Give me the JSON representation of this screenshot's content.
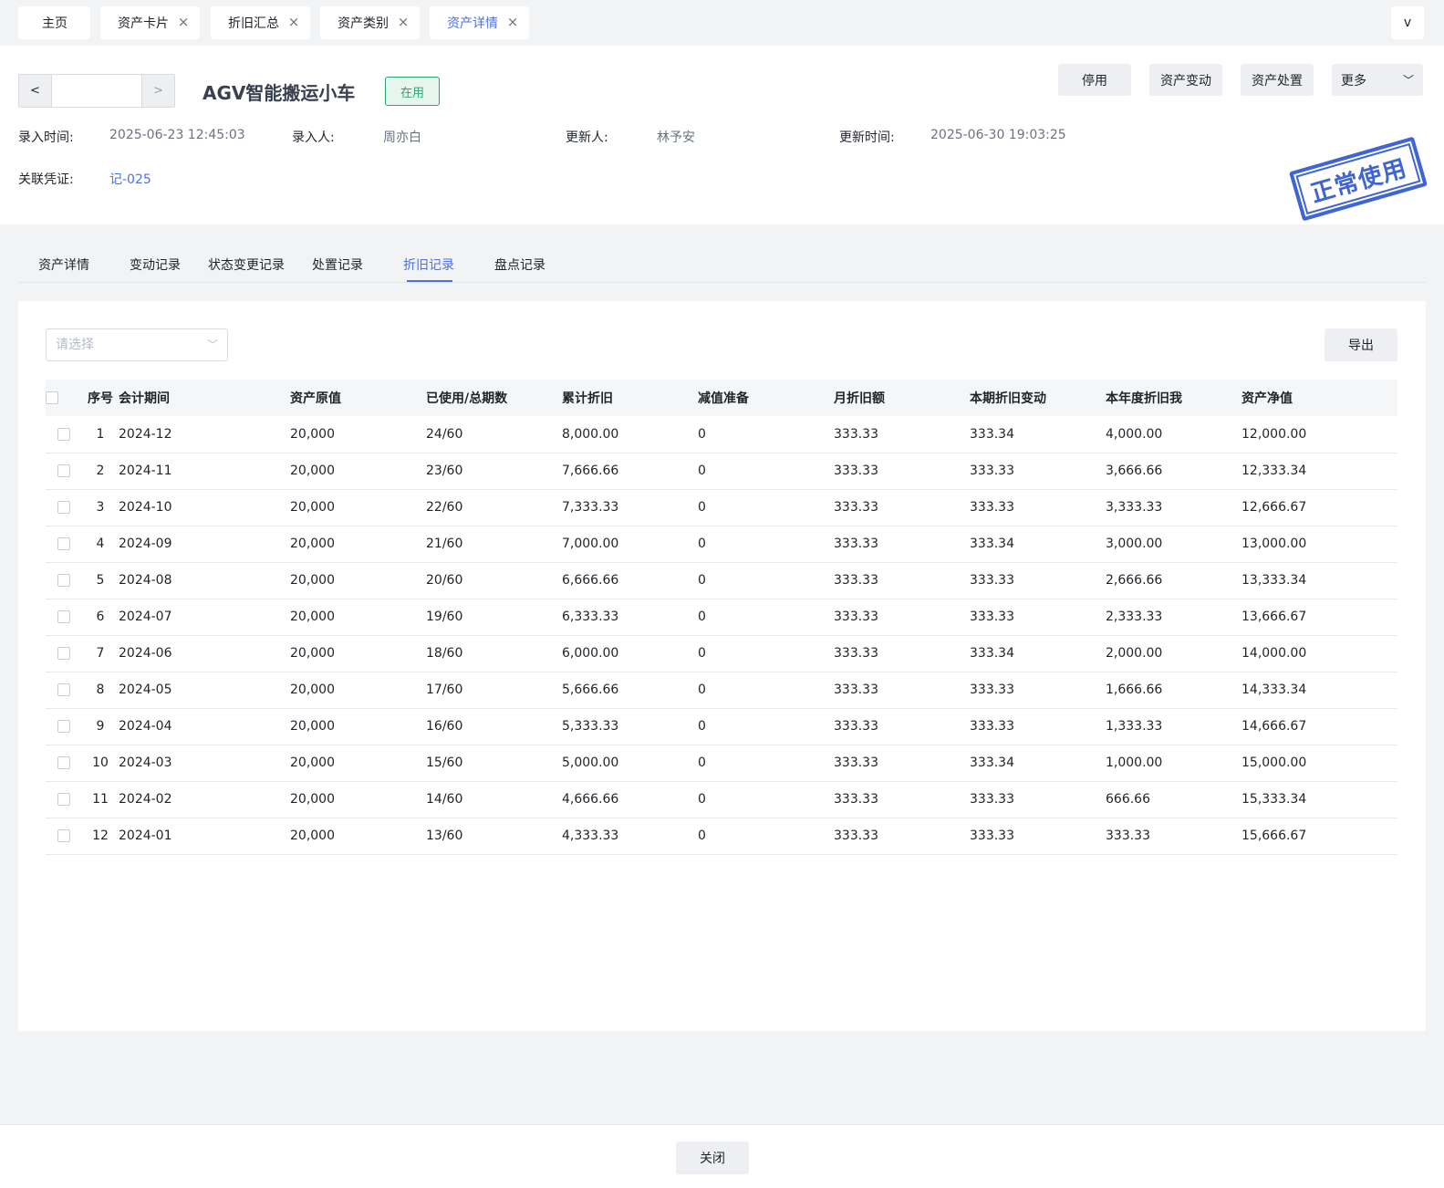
{
  "top_tabs": [
    {
      "label": "主页",
      "closable": false,
      "active": false
    },
    {
      "label": "资产卡片",
      "closable": true,
      "active": false
    },
    {
      "label": "折旧汇总",
      "closable": true,
      "active": false
    },
    {
      "label": "资产类别",
      "closable": true,
      "active": false
    },
    {
      "label": "资产详情",
      "closable": true,
      "active": true
    }
  ],
  "tabs_more_label": "v",
  "header": {
    "pager": {
      "prev": "<",
      "next": ">"
    },
    "asset_name": "AGV智能搬运小车",
    "status": "在用",
    "actions": {
      "disable": "停用",
      "change": "资产变动",
      "dispose": "资产处置",
      "more": "更多"
    },
    "meta": {
      "created_at_label": "录入时间:",
      "created_at": "2025-06-23 12:45:03",
      "creator_label": "录入人:",
      "creator": "周亦白",
      "updater_label": "更新人:",
      "updater": "林予安",
      "updated_at_label": "更新时间:",
      "updated_at": "2025-06-30 19:03:25",
      "voucher_label": "关联凭证:",
      "voucher": "记-025"
    },
    "stamp_text": "正常使用"
  },
  "sub_tabs": [
    "资产详情",
    "变动记录",
    "状态变更记录",
    "处置记录",
    "折旧记录",
    "盘点记录"
  ],
  "active_sub_tab": "折旧记录",
  "filter": {
    "placeholder": "请选择"
  },
  "export_label": "导出",
  "table": {
    "columns": [
      "序号",
      "会计期间",
      "资产原值",
      "已使用/总期数",
      "累计折旧",
      "减值准备",
      "月折旧额",
      "本期折旧变动",
      "本年度折旧我",
      "资产净值"
    ],
    "rows": [
      [
        "1",
        "2024-12",
        "20,000",
        "24/60",
        "8,000.00",
        "0",
        "333.33",
        "333.34",
        "4,000.00",
        "12,000.00"
      ],
      [
        "2",
        "2024-11",
        "20,000",
        "23/60",
        "7,666.66",
        "0",
        "333.33",
        "333.33",
        "3,666.66",
        "12,333.34"
      ],
      [
        "3",
        "2024-10",
        "20,000",
        "22/60",
        "7,333.33",
        "0",
        "333.33",
        "333.33",
        "3,333.33",
        "12,666.67"
      ],
      [
        "4",
        "2024-09",
        "20,000",
        "21/60",
        "7,000.00",
        "0",
        "333.33",
        "333.34",
        "3,000.00",
        "13,000.00"
      ],
      [
        "5",
        "2024-08",
        "20,000",
        "20/60",
        "6,666.66",
        "0",
        "333.33",
        "333.33",
        "2,666.66",
        "13,333.34"
      ],
      [
        "6",
        "2024-07",
        "20,000",
        "19/60",
        "6,333.33",
        "0",
        "333.33",
        "333.33",
        "2,333.33",
        "13,666.67"
      ],
      [
        "7",
        "2024-06",
        "20,000",
        "18/60",
        "6,000.00",
        "0",
        "333.33",
        "333.34",
        "2,000.00",
        "14,000.00"
      ],
      [
        "8",
        "2024-05",
        "20,000",
        "17/60",
        "5,666.66",
        "0",
        "333.33",
        "333.33",
        "1,666.66",
        "14,333.34"
      ],
      [
        "9",
        "2024-04",
        "20,000",
        "16/60",
        "5,333.33",
        "0",
        "333.33",
        "333.33",
        "1,333.33",
        "14,666.67"
      ],
      [
        "10",
        "2024-03",
        "20,000",
        "15/60",
        "5,000.00",
        "0",
        "333.33",
        "333.34",
        "1,000.00",
        "15,000.00"
      ],
      [
        "11",
        "2024-02",
        "20,000",
        "14/60",
        "4,666.66",
        "0",
        "333.33",
        "333.33",
        "666.66",
        "15,333.34"
      ],
      [
        "12",
        "2024-01",
        "20,000",
        "13/60",
        "4,333.33",
        "0",
        "333.33",
        "333.33",
        "333.33",
        "15,666.67"
      ]
    ]
  },
  "footer": {
    "close_label": "关闭"
  },
  "colors": {
    "accent": "#4e70e0",
    "status_green": "#2aa676",
    "stamp_blue": "#3f64d3"
  }
}
